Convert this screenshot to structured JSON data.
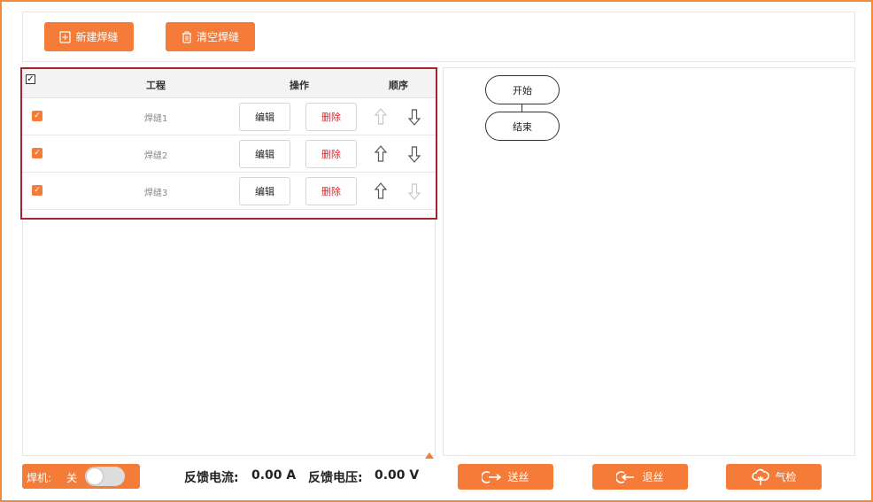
{
  "toolbar": {
    "new_weld": "新建焊缝",
    "clear_weld": "清空焊缝"
  },
  "table": {
    "header_check": "✓",
    "col_project": "工程",
    "col_operation": "操作",
    "col_order": "顺序",
    "rows": [
      {
        "name": "焊缝1",
        "edit": "编辑",
        "delete": "删除"
      },
      {
        "name": "焊缝2",
        "edit": "编辑",
        "delete": "删除"
      },
      {
        "name": "焊缝3",
        "edit": "编辑",
        "delete": "删除"
      }
    ]
  },
  "flow": {
    "start": "开始",
    "end": "结束"
  },
  "bottom": {
    "welder_label": "焊机:",
    "welder_state": "关",
    "current_label": "反馈电流:",
    "current_value": "0.00 A",
    "voltage_label": "反馈电压:",
    "voltage_value": "0.00 V",
    "feed_wire": "送丝",
    "retract_wire": "退丝",
    "gas_check": "气检"
  },
  "colors": {
    "accent": "#f47b38",
    "frame": "#f08a3c",
    "highlight": "#a8222a",
    "danger": "#e0242e"
  }
}
